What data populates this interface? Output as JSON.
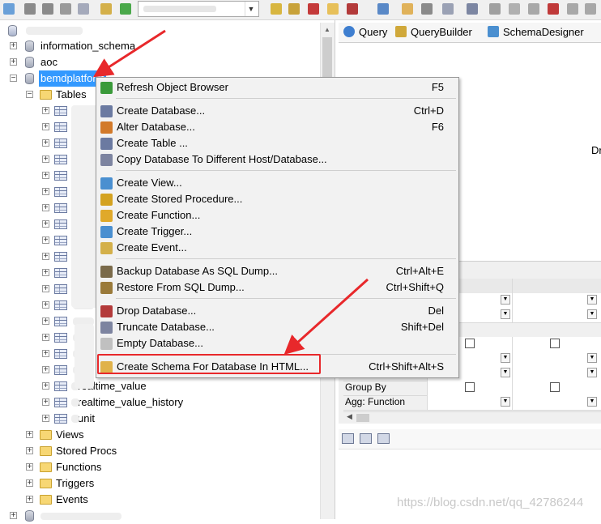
{
  "right_tabs": [
    {
      "label": "Query",
      "icon": "query-icon"
    },
    {
      "label": "QueryBuilder",
      "icon": "query-builder-icon"
    },
    {
      "label": "SchemaDesigner",
      "icon": "schema-designer-icon"
    }
  ],
  "tree": {
    "databases": [
      {
        "name": "information_schema"
      },
      {
        "name": "aoc"
      },
      {
        "name": "bemdplatform"
      }
    ],
    "tables_folder": "Tables",
    "visible_table_names": [
      "realtime_value",
      "realtime_value_history",
      "unit"
    ],
    "other_folders": [
      "Views",
      "Stored Procs",
      "Functions",
      "Triggers",
      "Events"
    ]
  },
  "context_menu": {
    "items": [
      {
        "label": "Refresh Object Browser",
        "shortcut": "F5",
        "icon": "refresh-icon"
      },
      {
        "label": "Create Database...",
        "shortcut": "Ctrl+D",
        "icon": "create-database-icon"
      },
      {
        "label": "Alter Database...",
        "shortcut": "F6",
        "icon": "alter-database-icon"
      },
      {
        "label": "Create Table ...",
        "shortcut": "",
        "icon": "create-table-icon"
      },
      {
        "label": "Copy Database To Different Host/Database...",
        "shortcut": "",
        "icon": "copy-database-icon"
      },
      {
        "label": "Create View...",
        "shortcut": "",
        "icon": "create-view-icon"
      },
      {
        "label": "Create Stored Procedure...",
        "shortcut": "",
        "icon": "create-procedure-icon"
      },
      {
        "label": "Create Function...",
        "shortcut": "",
        "icon": "create-function-icon"
      },
      {
        "label": "Create Trigger...",
        "shortcut": "",
        "icon": "create-trigger-icon"
      },
      {
        "label": "Create Event...",
        "shortcut": "",
        "icon": "create-event-icon"
      },
      {
        "label": "Backup Database As SQL Dump...",
        "shortcut": "Ctrl+Alt+E",
        "icon": "backup-icon"
      },
      {
        "label": "Restore From SQL Dump...",
        "shortcut": "Ctrl+Shift+Q",
        "icon": "restore-icon"
      },
      {
        "label": "Drop Database...",
        "shortcut": "Del",
        "icon": "drop-database-icon"
      },
      {
        "label": "Truncate Database...",
        "shortcut": "Shift+Del",
        "icon": "truncate-database-icon"
      },
      {
        "label": "Empty Database...",
        "shortcut": "",
        "icon": "empty-database-icon"
      },
      {
        "label": "Create Schema For Database In HTML...",
        "shortcut": "Ctrl+Shift+Alt+S",
        "icon": "create-schema-html-icon"
      }
    ]
  },
  "editor_partial_text": "Dr",
  "query_builder_grid": {
    "row_labels": [
      "Group By",
      "Agg: Function"
    ]
  },
  "watermark": "https://blog.csdn.net/qq_42786244",
  "colors": {
    "selection": "#3399ff",
    "annotation": "#e8282b",
    "menu_background": "#f2f2f2"
  }
}
